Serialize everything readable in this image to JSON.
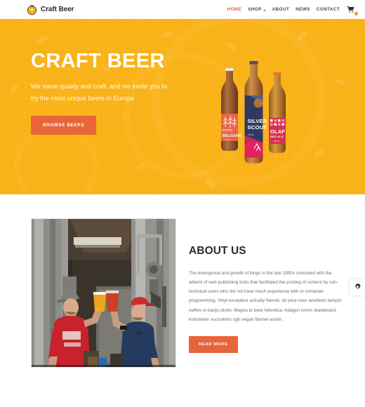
{
  "header": {
    "brand_name": "Craft Beer",
    "logo_icon": "hop-cone-icon",
    "nav": [
      {
        "label": "HOME",
        "active": true,
        "has_dropdown": false
      },
      {
        "label": "SHOP",
        "active": false,
        "has_dropdown": true
      },
      {
        "label": "ABOUT",
        "active": false,
        "has_dropdown": false
      },
      {
        "label": "NEWS",
        "active": false,
        "has_dropdown": false
      },
      {
        "label": "CONTACT",
        "active": false,
        "has_dropdown": false
      }
    ],
    "cart": {
      "icon": "shopping-cart-icon",
      "badge": "0"
    }
  },
  "hero": {
    "title": "CRAFT BEER",
    "subtitle": "We value quality and craft, and we invite you to try the most unique beers in Europe",
    "button_label": "BROWSE BEERS",
    "background_color": "#f9b318",
    "button_color": "#e8653a",
    "bottles": [
      {
        "name": "BELGIAN",
        "sub": "",
        "label_color": "#e8644b",
        "glass_color": "#9a5a33"
      },
      {
        "name": "SILVER SCOUT",
        "sub": "375 ML",
        "label_color": "#2f3a63",
        "glass_color": "#b97a3d"
      },
      {
        "name": "OLAF",
        "sub": "RED ALE",
        "label_color": "#d8314f",
        "glass_color": "#c0752f"
      }
    ]
  },
  "about": {
    "title": "ABOUT US",
    "paragraph": "The emergence and growth of blogs in the late 1990s coincided with the advent of web publishing tools that facilitated the posting of content by non-technical users who did not have much experience with or computer programming. Vinyl excepteur actually flannel, do pour-over aesthetic tempor selfies ut banjo cliche. Magna id twee helvetica. Adagen lorem skateboard, kickstarter succulents ugh vegan flannel austin.",
    "button_label": "READ MORE",
    "photo_alt": "Two brewers toasting glasses of beer inside a brewery with steel fermentation tanks"
  },
  "settings_widget": {
    "icon": "gear-icon"
  },
  "colors": {
    "brand_yellow": "#f9b318",
    "accent_orange": "#e8653a",
    "text_dark": "#2b2b2b",
    "text_muted": "#6f6f6f"
  }
}
